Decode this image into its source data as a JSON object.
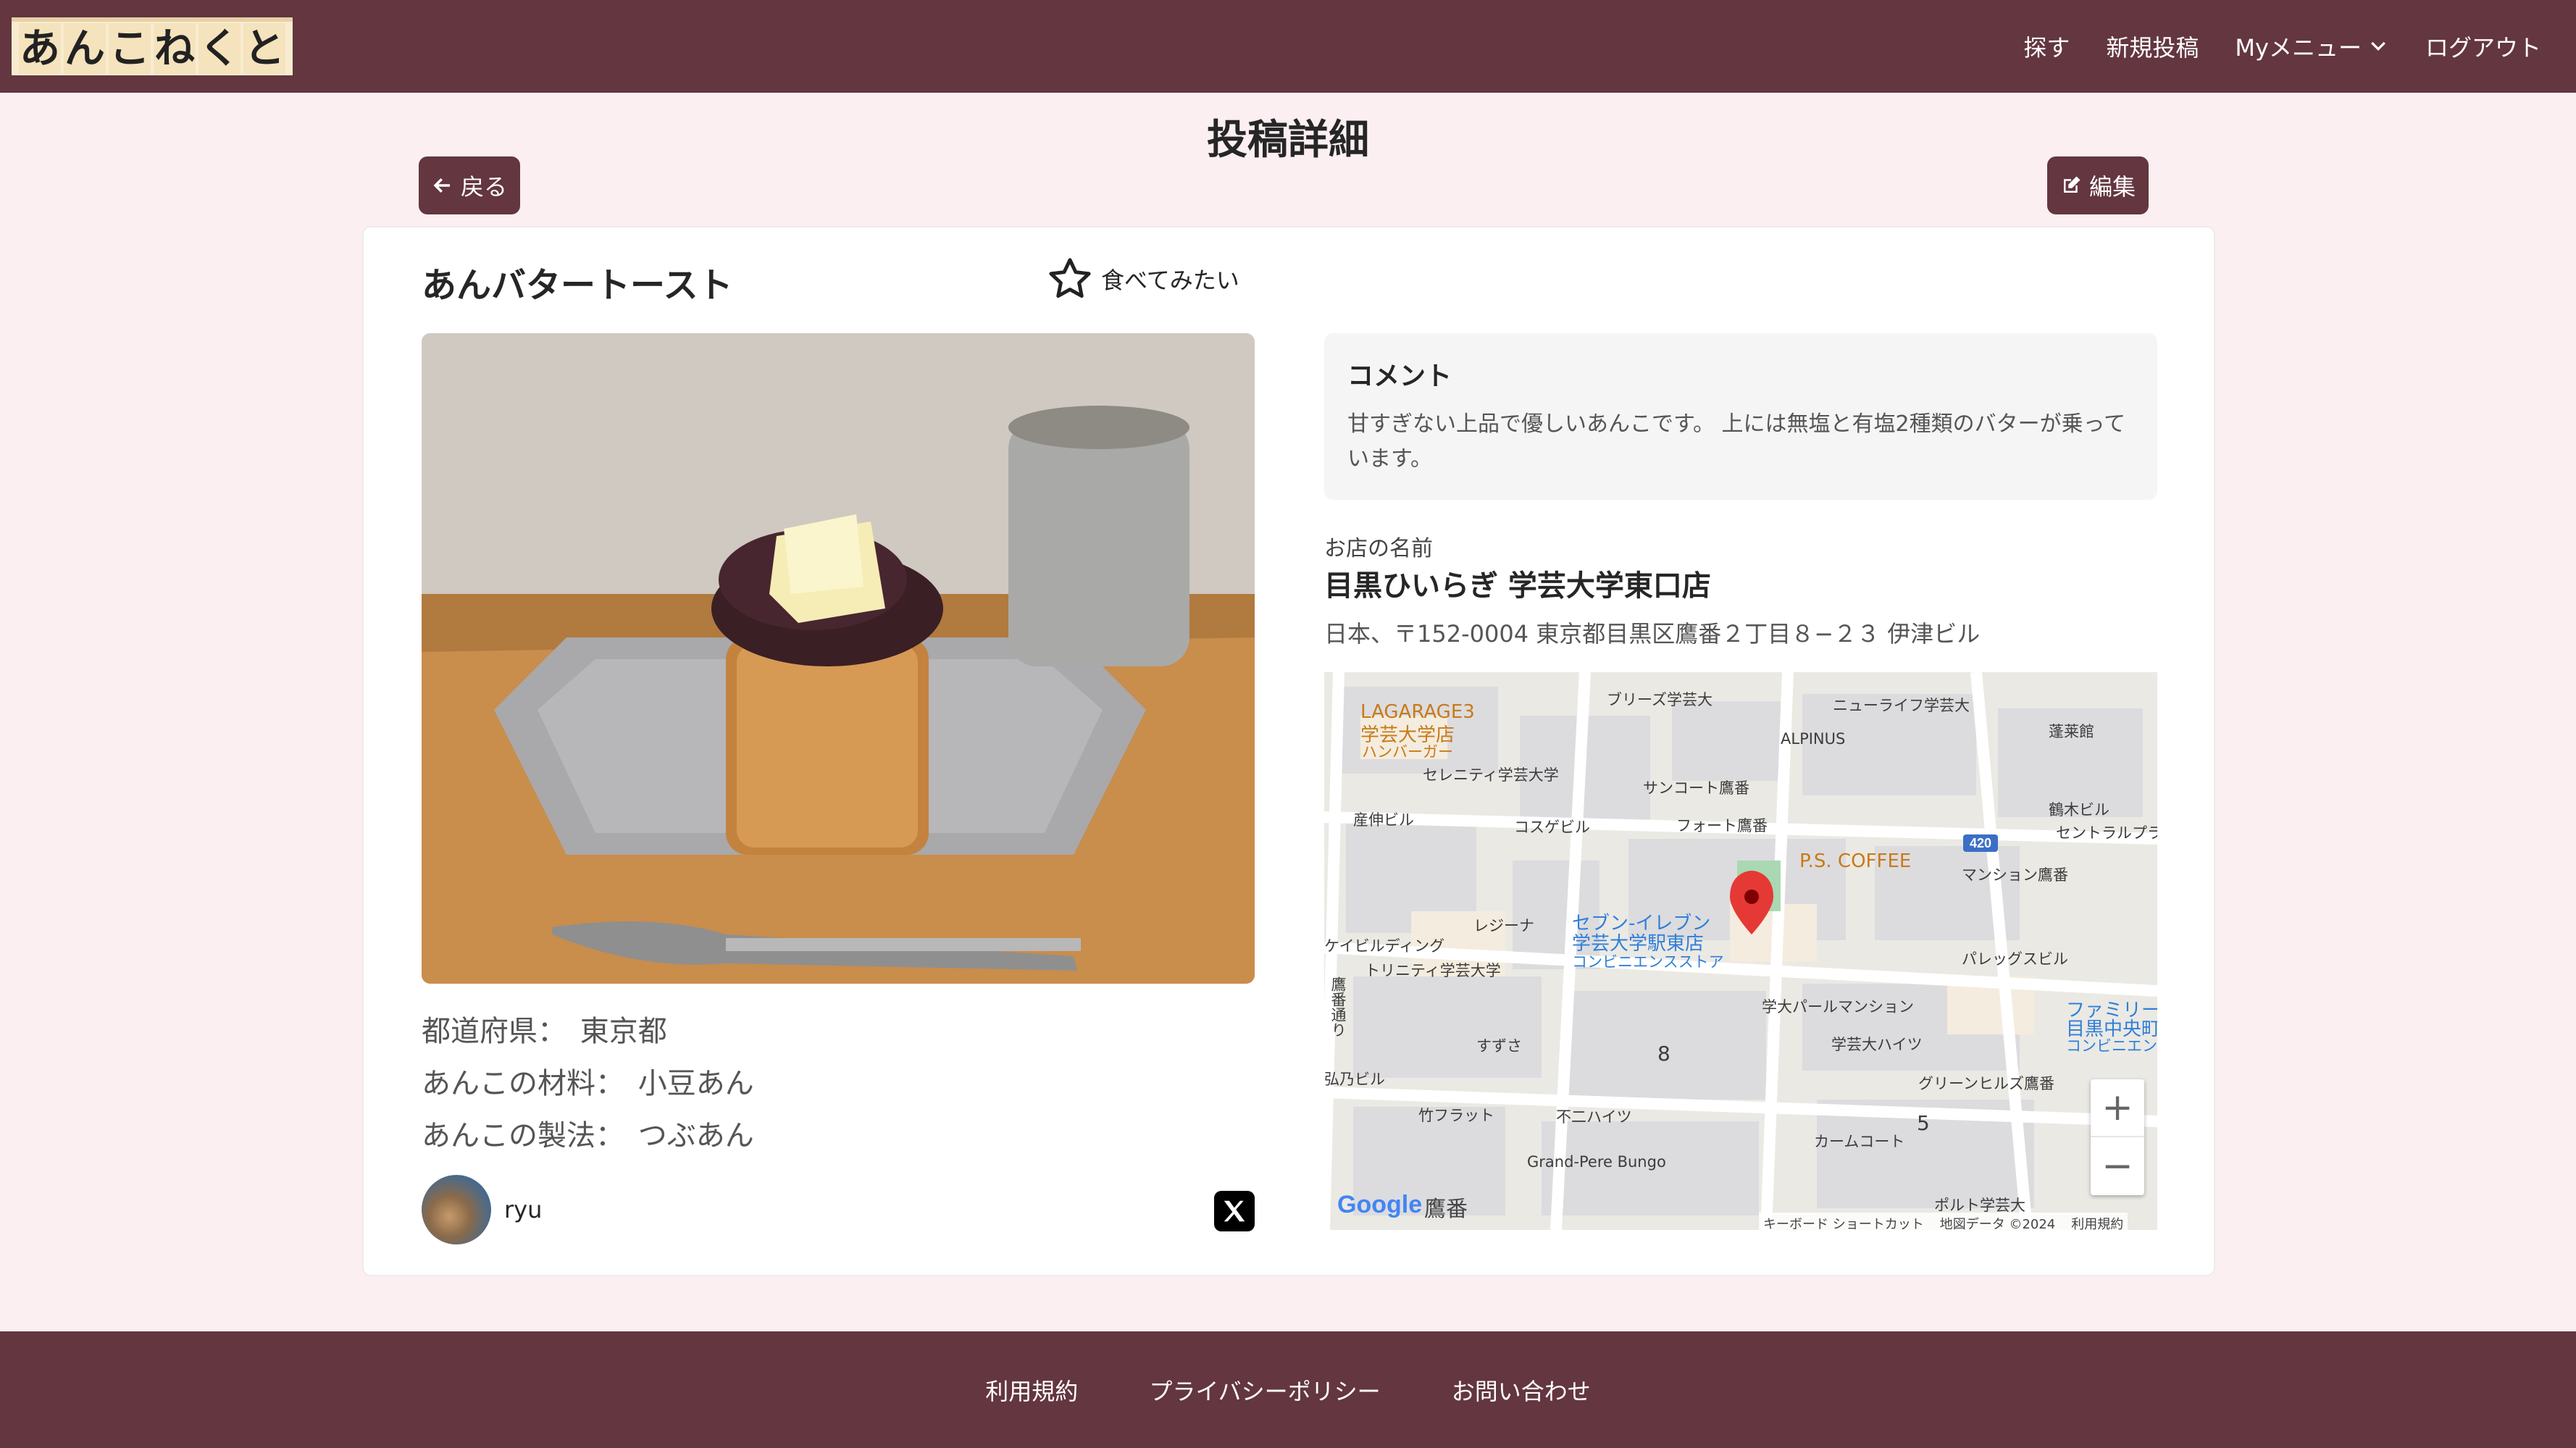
{
  "header": {
    "logo_chars": [
      "あ",
      "ん",
      "こ",
      "ね",
      "く",
      "と"
    ],
    "nav": {
      "search": "探す",
      "new_post": "新規投稿",
      "my_menu": "Myメニュー",
      "logout": "ログアウト"
    }
  },
  "page": {
    "title": "投稿詳細",
    "back_label": "戻る",
    "edit_label": "編集"
  },
  "post": {
    "title": "あんバタートースト",
    "want_to_eat_label": "食べてみたい",
    "attributes": [
      {
        "label": "都道府県：",
        "value": "東京都"
      },
      {
        "label": "あんこの材料：",
        "value": "小豆あん"
      },
      {
        "label": "あんこの製法：",
        "value": "つぶあん"
      }
    ],
    "user": {
      "name": "ryu"
    },
    "share_icon": "x-logo-icon"
  },
  "comment": {
    "heading": "コメント",
    "text": "甘すぎない上品で優しいあんこです。 上には無塩と有塩2種類のバターが乗っています。"
  },
  "shop": {
    "label": "お店の名前",
    "name": "目黒ひいらぎ 学芸大学東口店",
    "address": "日本、〒152-0004 東京都目黒区鷹番２丁目８−２３ 伊津ビル"
  },
  "map": {
    "labels": {
      "lagarage": "LAGARAGE3",
      "lagarage_sub": "学芸大学店",
      "lagarage_sub2": "ハンバーガー",
      "breeze": "ブリーズ学芸大",
      "newlife": "ニューライフ学芸大",
      "hourai": "蓬莱館",
      "alpinus": "ALPINUS",
      "serenity": "セレニティ学芸大学",
      "suncourt": "サンコート鷹番",
      "tsuruki": "鶴木ビル",
      "central": "セントラルプラザ",
      "sanshin": "産伸ビル",
      "kozage": "コスゲビル",
      "fort": "フォート鷹番",
      "pscoffee": "P.S. COFFEE",
      "mansion": "マンション鷹番",
      "seven": "セブン-イレブン",
      "seven_sub": "学芸大学駅東店",
      "seven_sub2": "コンビニエンスストア",
      "regina": "レジーナ",
      "building": "ケイビルディング",
      "trinity": "トリニティ学芸大学",
      "palleg": "パレッグスビル",
      "family": "ファミリー",
      "family_sub": "目黒中央町",
      "family_sub2": "コンビニエン",
      "gakudai_pearl": "学大パールマンション",
      "suzusa": "すずさ",
      "gakugei_heights": "学芸大ハイツ",
      "greenhills": "グリーンヒルズ鷹番",
      "hino_bldg": "弘乃ビル",
      "takeflat": "竹フラット",
      "fuji_heights": "不二ハイツ",
      "camu_court": "カームコート",
      "grand_pere": "Grand-Pere Bungo",
      "porte": "ポルト学芸大",
      "street": "鷹番通り",
      "route": "420",
      "area_num_8": "8",
      "area_num_5": "5"
    },
    "area_name": "鷹番",
    "google": "Google",
    "footer": {
      "shortcuts": "キーボード ショートカット",
      "data": "地図データ ©2024",
      "terms": "利用規約"
    },
    "zoom_in": "+",
    "zoom_out": "−"
  },
  "footer": {
    "terms": "利用規約",
    "privacy": "プライバシーポリシー",
    "contact": "お問い合わせ"
  },
  "colors": {
    "brand": "#633640",
    "background": "#fbeff2",
    "pin": "#e53935"
  }
}
